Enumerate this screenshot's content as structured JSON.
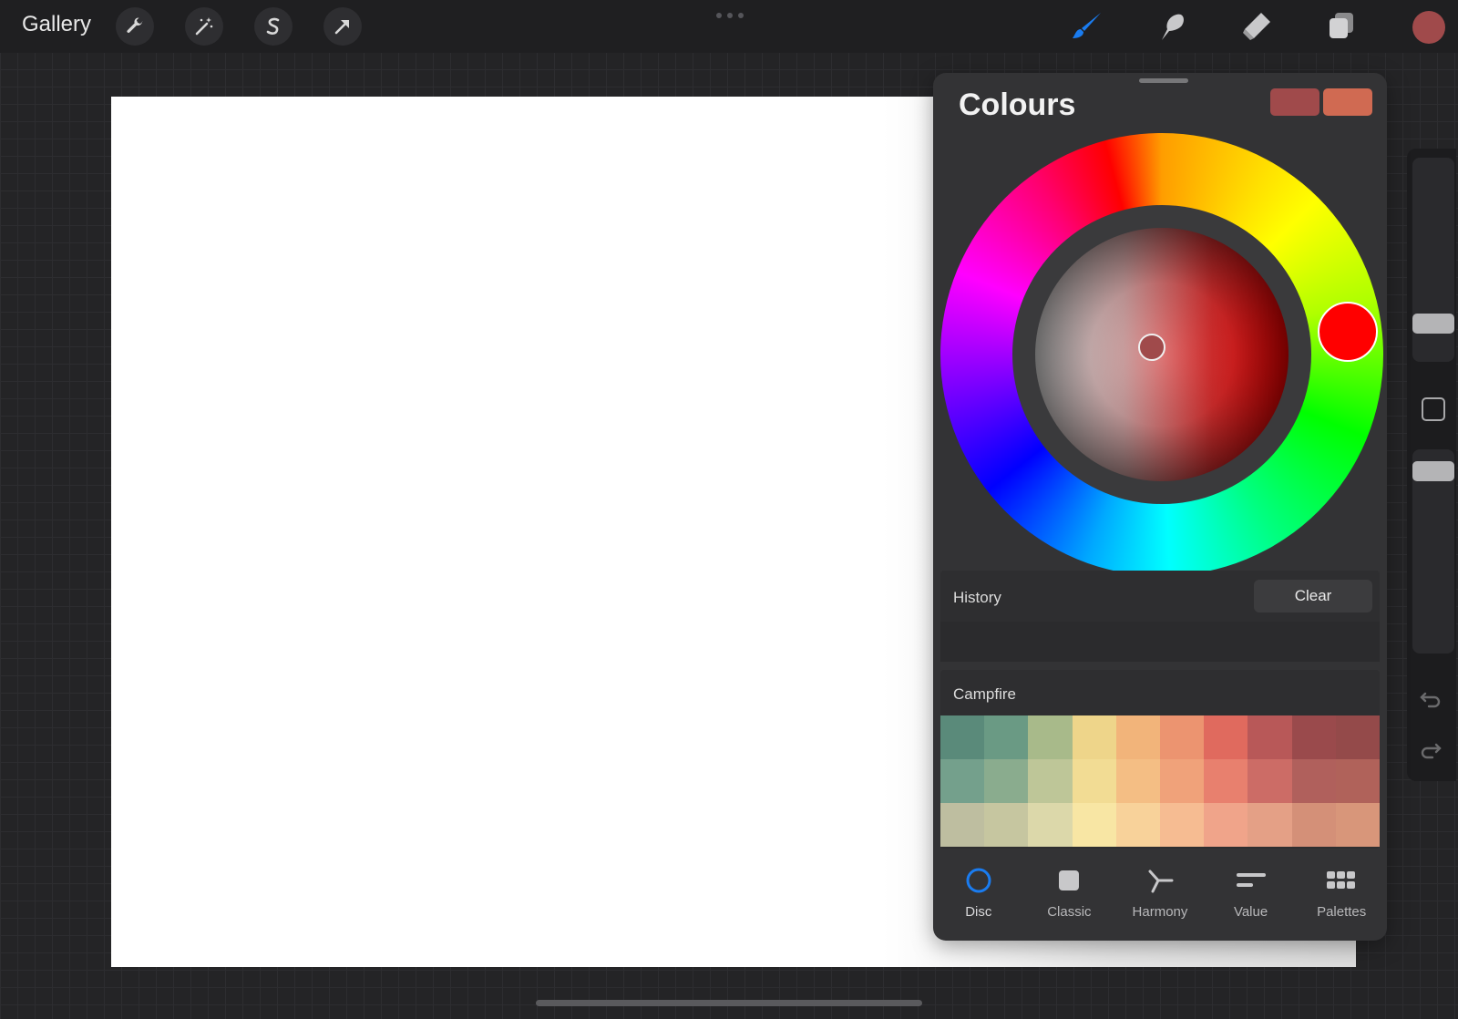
{
  "topbar": {
    "gallery_label": "Gallery",
    "actions": [
      "wrench-icon",
      "magic-wand-icon",
      "selection-s-icon",
      "transform-arrow-icon"
    ],
    "tools": [
      "brush-icon",
      "smudge-icon",
      "eraser-icon",
      "layers-icon"
    ],
    "current_color": "#a04a4b"
  },
  "colors_panel": {
    "title": "Colours",
    "primary_color": "#a04a4b",
    "secondary_color": "#d06a52",
    "selected_hue": "#ff0000",
    "history": {
      "label": "History",
      "clear_label": "Clear"
    },
    "palette": {
      "name": "Campfire",
      "rows": [
        [
          "#5a8a7a",
          "#6a9a84",
          "#a8ba8a",
          "#eed58a",
          "#f2b47a",
          "#ec9470",
          "#e06a5e",
          "#b85858",
          "#9a4a4c",
          "#944a4a"
        ],
        [
          "#74a08c",
          "#8aac8e",
          "#bec698",
          "#f2dc94",
          "#f4be84",
          "#f0a27a",
          "#e8806e",
          "#cc6c66",
          "#b0605c",
          "#b0625a"
        ],
        [
          "#bebea0",
          "#c6c6a0",
          "#dcd8aa",
          "#f8e6a4",
          "#f8d29a",
          "#f6bc92",
          "#f0a48a",
          "#e4a086",
          "#d49078",
          "#d8967a"
        ]
      ]
    },
    "tabs": [
      {
        "label": "Disc",
        "icon": "disc-icon",
        "active": true
      },
      {
        "label": "Classic",
        "icon": "classic-icon",
        "active": false
      },
      {
        "label": "Harmony",
        "icon": "harmony-icon",
        "active": false
      },
      {
        "label": "Value",
        "icon": "value-icon",
        "active": false
      },
      {
        "label": "Palettes",
        "icon": "palettes-icon",
        "active": false
      }
    ]
  },
  "colors": {
    "accent_blue": "#1a7cf0",
    "panel_bg": "#333335"
  }
}
